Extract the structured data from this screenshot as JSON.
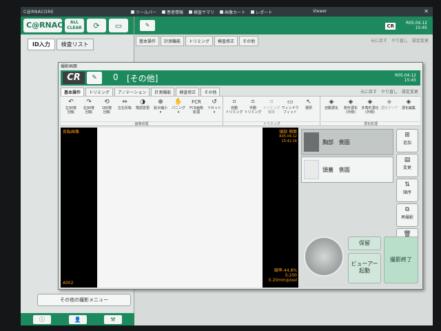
{
  "taskbar": {
    "brand": "C@RNACORE",
    "items": [
      "ツールバー",
      "患者情報",
      "検査サマリ",
      "画像カート",
      "レポート"
    ],
    "viewer": "Viewer",
    "close": "✕"
  },
  "left_panel": {
    "logo": "C@RNACO",
    "all_clear": "ALL CLEAR",
    "tabs": [
      "ID入力",
      "検査リスト"
    ],
    "other_menu": "その他の撮影メニュー"
  },
  "viewer_window": {
    "tabs": [
      "基本操作",
      "計測機能",
      "トリミング",
      "検査修正",
      "その他"
    ],
    "right_actions": [
      "元に戻す",
      "やり直し",
      "設定変更"
    ],
    "cr_label": "CR",
    "date": "R05.04.12",
    "time": "15:45"
  },
  "dialog": {
    "title": "撮影画面",
    "cr_logo": "CR",
    "exam_number": "0",
    "exam_name": "[その他]",
    "date": "R05.04.12",
    "time": "15:45",
    "tabs": [
      "基本操作",
      "トリミング",
      "アノテーション",
      "計測機能",
      "検査修正",
      "その他"
    ],
    "right_actions": [
      "元に戻す",
      "やり直し",
      "設定変更"
    ],
    "toolbar_groups": {
      "image_processing": {
        "label": "画像処理",
        "buttons": [
          {
            "icon": "↶",
            "label1": "左90度",
            "label2": "回転"
          },
          {
            "icon": "↷",
            "label1": "右90度",
            "label2": "回転"
          },
          {
            "icon": "⟲",
            "label1": "180度",
            "label2": "回転"
          },
          {
            "icon": "⇔",
            "label1": "左右反転",
            "label2": ""
          },
          {
            "icon": "◑",
            "label1": "階調変更",
            "label2": ""
          },
          {
            "icon": "⊕",
            "label1": "拡大縮小",
            "label2": "▾"
          },
          {
            "icon": "✋",
            "label1": "パニング",
            "label2": "▾"
          },
          {
            "icon": "FCR",
            "label1": "FCR画像",
            "label2": "処理"
          },
          {
            "icon": "↺",
            "label1": "リセット",
            "label2": "▾"
          }
        ]
      },
      "trimming": {
        "label": "トリミング",
        "buttons": [
          {
            "icon": "⌗",
            "label1": "自動",
            "label2": "トリミング"
          },
          {
            "icon": "⌗",
            "label1": "手動",
            "label2": "トリミング"
          },
          {
            "icon": "⌗",
            "label1": "トリミング",
            "label2": "解除"
          },
          {
            "icon": "▭",
            "label1": "ウィンドウ",
            "label2": "フィット"
          },
          {
            "icon": "↖",
            "label1": "選択",
            "label2": ""
          }
        ]
      },
      "shade": {
        "label": "濃化処理",
        "buttons": [
          {
            "icon": "◈",
            "label1": "自動濃化",
            "label2": ""
          },
          {
            "icon": "◈",
            "label1": "矩形濃化",
            "label2": "(外側)"
          },
          {
            "icon": "◈",
            "label1": "多角形濃化",
            "label2": "(外側)"
          },
          {
            "icon": "◈",
            "label1": "濃化クリア",
            "label2": ""
          },
          {
            "icon": "◈",
            "label1": "濃化編集",
            "label2": ""
          }
        ]
      }
    },
    "image": {
      "top_left": "反転画像",
      "top_right_1": "頭部 側面",
      "top_right_2": "R05.04.12 15:42:16",
      "bottom_left": "A002",
      "bottom_right_1": "縮率:44.8%",
      "bottom_right_2": "S:200",
      "bottom_right_3": "0.20mm/pixel"
    },
    "list_items": [
      {
        "name": "胸部　側面"
      },
      {
        "name": "頭蓋　側面"
      }
    ],
    "side_buttons": [
      {
        "icon": "⊞",
        "label": "追加"
      },
      {
        "icon": "▤",
        "label": "変更"
      },
      {
        "icon": "⇅",
        "label": "順序"
      },
      {
        "icon": "⧉",
        "label": "再撮影"
      },
      {
        "icon": "🗑",
        "label": "削除"
      }
    ],
    "save_label": "保留",
    "viewer_launch_1": "ビューアー",
    "viewer_launch_2": "起動",
    "finish_label": "撮影終了"
  }
}
